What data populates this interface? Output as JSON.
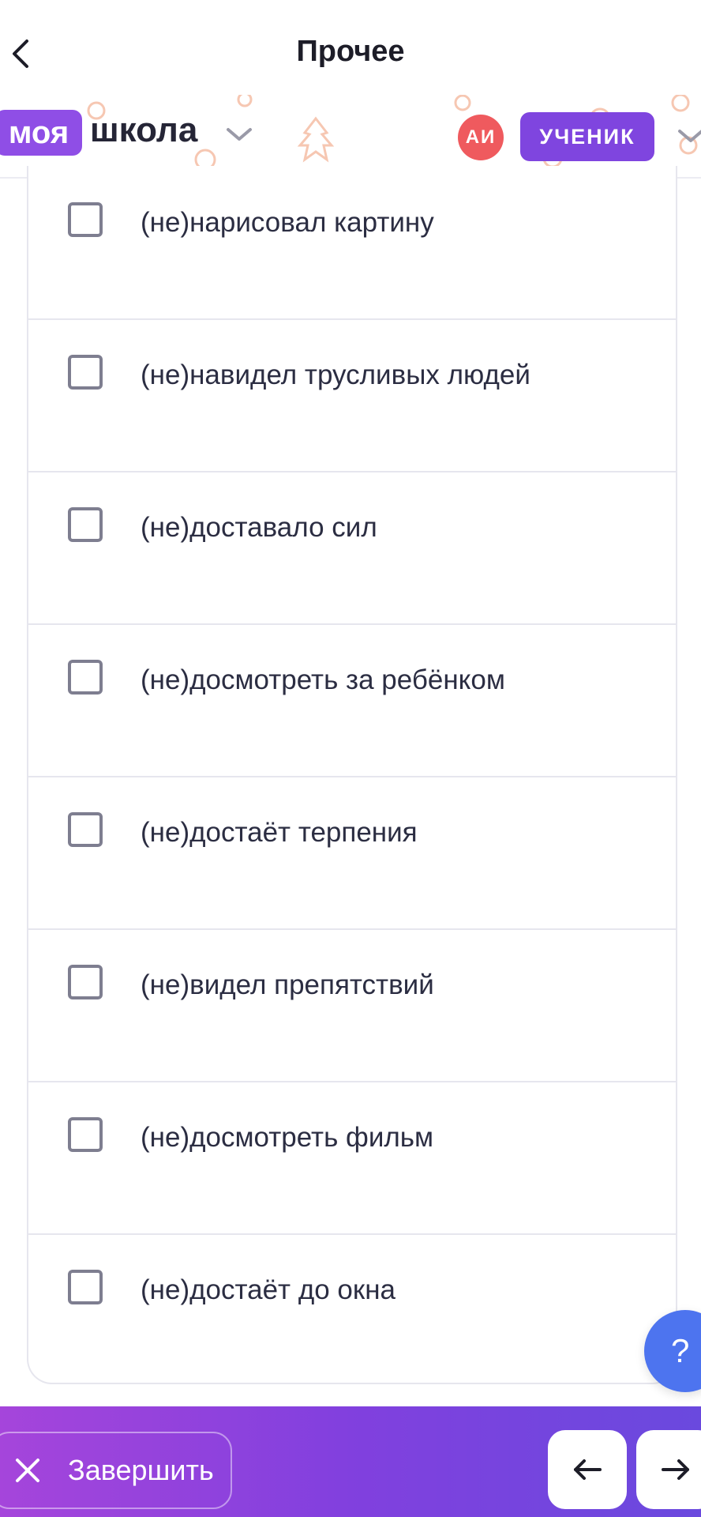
{
  "header": {
    "title": "Прочее",
    "back_icon": "chevron-left-icon"
  },
  "brand": {
    "logo_part1": "моя",
    "logo_part2": "школа",
    "avatar_initials": "АИ",
    "role": "УЧЕНИК",
    "colors": {
      "logo_purple": "#8f4ee6",
      "avatar_red": "#ef5a5e",
      "role_purple": "#7f45df"
    }
  },
  "options": [
    {
      "label": "(не)нарисовал картину",
      "checked": false
    },
    {
      "label": "(не)навидел трусливых людей",
      "checked": false
    },
    {
      "label": "(не)доставало сил",
      "checked": false
    },
    {
      "label": "(не)досмотреть за ребёнком",
      "checked": false
    },
    {
      "label": "(не)достаёт терпения",
      "checked": false
    },
    {
      "label": "(не)видел препятствий",
      "checked": false
    },
    {
      "label": "(не)досмотреть фильм",
      "checked": false
    },
    {
      "label": "(не)достаёт до окна",
      "checked": false
    }
  ],
  "help": {
    "label": "?"
  },
  "footer": {
    "finish_label": "Завершить",
    "prev_icon": "arrow-left-icon",
    "next_icon": "arrow-right-icon",
    "gradient": [
      "#a545db",
      "#6a49de"
    ]
  }
}
